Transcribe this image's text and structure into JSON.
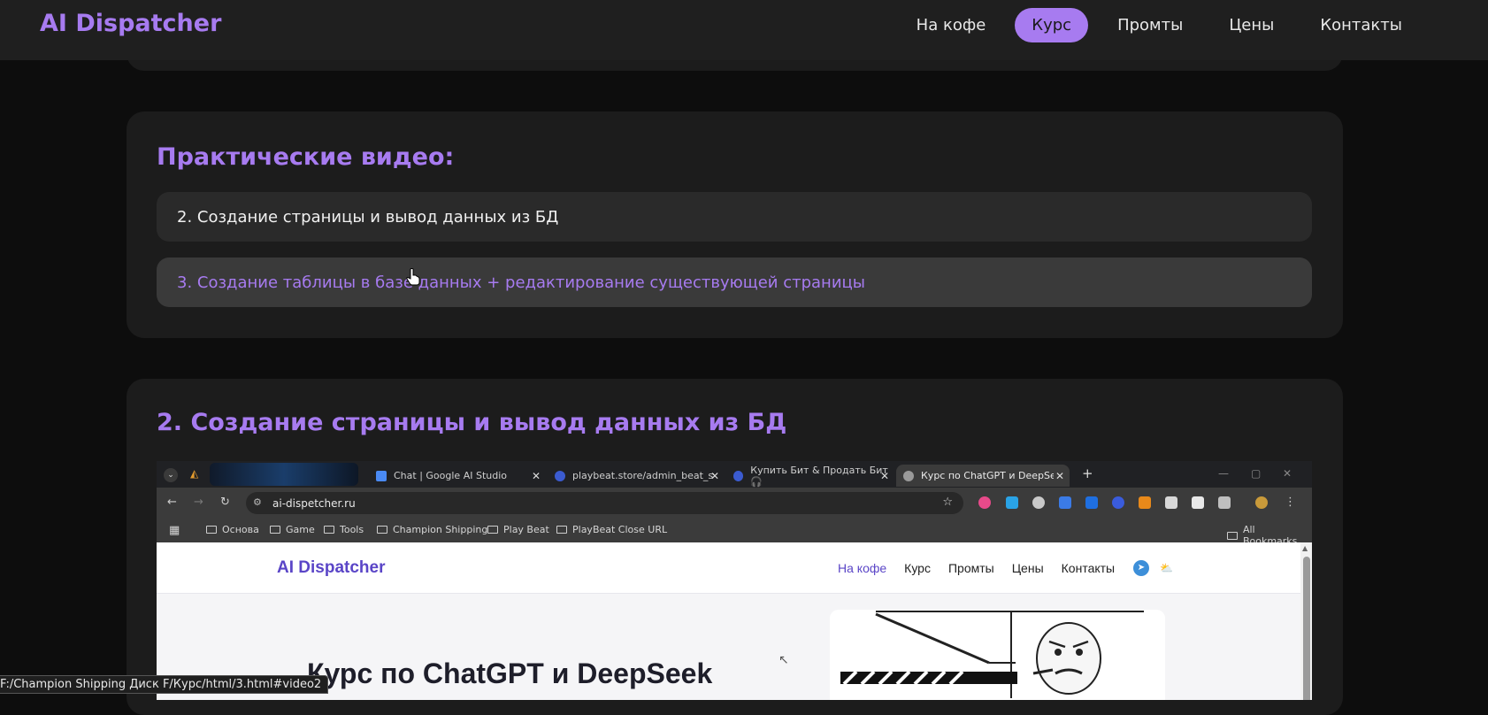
{
  "header": {
    "logo": "AI Dispatcher",
    "nav": [
      "На кофе",
      "Курс",
      "Промты",
      "Цены",
      "Контакты"
    ],
    "active": "Курс"
  },
  "videos_section": {
    "title": "Практические видео:",
    "items": [
      "2. Создание страницы и вывод данных из БД",
      "3. Создание таблицы в базе данных + редактирование существующей страницы"
    ]
  },
  "lesson": {
    "title": "2. Создание страницы и вывод данных из БД"
  },
  "embedded_browser": {
    "tabs": [
      {
        "label": "Chat | Google AI Studio"
      },
      {
        "label": "playbeat.store/admin_beat_stat"
      },
      {
        "label": "Купить Бит & Продать Бит 🎧"
      },
      {
        "label": "Курс по ChatGPT и DeepSeek |"
      }
    ],
    "url": "ai-dispetcher.ru",
    "bookmarks": [
      "Основа",
      "Game",
      "Tools",
      "Champion Shipping",
      "Play Beat",
      "PlayBeat Close URL"
    ],
    "all_bookmarks": "All Bookmarks",
    "page": {
      "logo": "AI Dispatcher",
      "nav": [
        "На кофе",
        "Курс",
        "Промты",
        "Цены",
        "Контакты"
      ],
      "hero_title": "Курс по ChatGPT и DeepSeek"
    }
  },
  "status_url": "F:/Champion Shipping Диск F/Курс/html/3.html#video2",
  "colors": {
    "accent": "#a77bf0",
    "background": "#0d0d0d",
    "card": "#1c1c1c"
  }
}
